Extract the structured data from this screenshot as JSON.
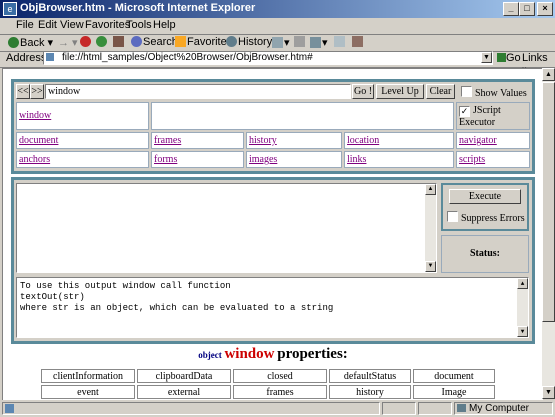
{
  "window": {
    "title": "ObjBrowser.htm - Microsoft Internet Explorer",
    "minimize": "_",
    "maximize": "□",
    "close": "×"
  },
  "menu": [
    "File",
    "Edit",
    "View",
    "Favorites",
    "Tools",
    "Help"
  ],
  "toolbar": {
    "back": "Back",
    "forward": "→",
    "search": "Search",
    "favorites": "Favorites",
    "history": "History"
  },
  "address": {
    "label": "Address",
    "url": "file://html_samples/Object%20Browser/ObjBrowser.htm#",
    "go": "Go",
    "links": "Links"
  },
  "browser": {
    "nav_back": "<<",
    "nav_forward": ">>",
    "object_input": "window",
    "go_btn": "Go !",
    "levelup_btn": "Level Up",
    "clear_btn": "Clear",
    "show_values": "Show Values",
    "current_object": "window",
    "jscript_executor": "JScript Executor",
    "links_row1": [
      "document",
      "frames",
      "history",
      "location",
      "navigator"
    ],
    "links_row2": [
      "anchors",
      "forms",
      "images",
      "links",
      "scripts"
    ],
    "execute_btn": "Execute",
    "suppress_errors": "Suppress Errors",
    "status_label": "Status:",
    "output_lines": [
      "To use this output window call function",
      "textOut(str)",
      "where str is an object, which can be evaluated to a string"
    ],
    "heading_object": "object",
    "heading_name": "window",
    "heading_props": "properties:",
    "properties": [
      [
        "clientInformation",
        "clipboardData",
        "closed",
        "defaultStatus",
        "document"
      ],
      [
        "event",
        "external",
        "frames",
        "history",
        "Image"
      ]
    ]
  },
  "status": {
    "zone": "My Computer"
  }
}
